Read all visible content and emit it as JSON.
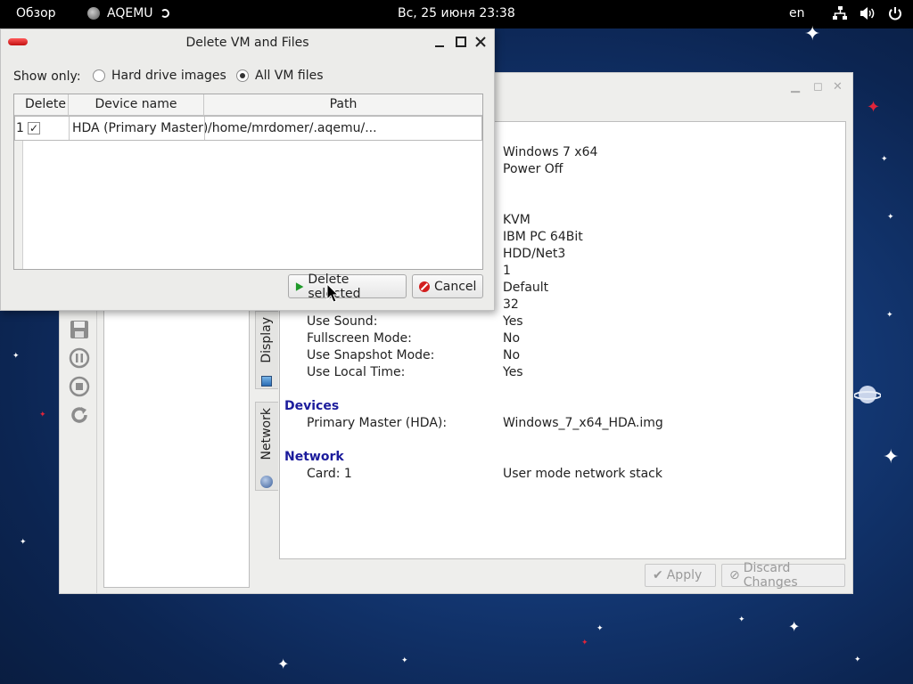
{
  "topbar": {
    "overview": "Обзор",
    "app_name": "AQEMU",
    "clock": "Вс, 25 июня  23:38",
    "language": "en"
  },
  "dialog": {
    "title": "Delete VM and Files",
    "show_only_label": "Show only:",
    "radio_hdd": "Hard drive images",
    "radio_all": "All VM files",
    "radio_selected": "all",
    "table": {
      "headers": [
        "Delete",
        "Device name",
        "Path"
      ],
      "rows": [
        {
          "num": "1",
          "checked": "✓",
          "device": "HDA (Primary Master)",
          "path": "/home/mrdomer/.aqemu/..."
        }
      ]
    },
    "delete_button": "Delete selected",
    "cancel_button": "Cancel"
  },
  "main": {
    "values_top": [
      "Windows 7 x64",
      "Power Off",
      "KVM",
      "IBM PC 64Bit",
      "HDD/Net3",
      "1",
      "Default",
      "32"
    ],
    "rows": [
      {
        "label": "Use Sound:",
        "value": "Yes"
      },
      {
        "label": "Fullscreen Mode:",
        "value": "No"
      },
      {
        "label": "Use Snapshot Mode:",
        "value": "No"
      },
      {
        "label": "Use Local Time:",
        "value": "Yes"
      }
    ],
    "devices_section": "Devices",
    "device_row": {
      "label": "Primary Master (HDA):",
      "value": "Windows_7_x64_HDA.img"
    },
    "network_section": "Network",
    "network_row": {
      "label": "Card: 1",
      "value": "User mode network stack"
    },
    "tabs": [
      "Display",
      "Network"
    ],
    "apply_button": "Apply",
    "discard_button": "Discard Changes"
  },
  "colors": {
    "section_header": "#1c1c9c",
    "topbar_bg": "#000000",
    "star_red": "#e0243a"
  }
}
